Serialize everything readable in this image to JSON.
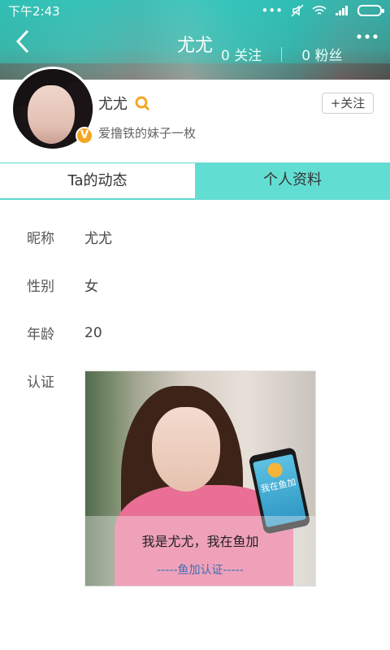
{
  "status_bar": {
    "time": "下午2:43",
    "signal_dots": "•••"
  },
  "header": {
    "title": "尤尤",
    "following": "0 关注",
    "followers": "0 粉丝"
  },
  "profile": {
    "nickname": "尤尤",
    "signature": "爱撸铁的妹子一枚",
    "badge": "V",
    "follow_button": "+关注"
  },
  "tabs": [
    {
      "label": "Ta的动态",
      "active": false
    },
    {
      "label": "个人资料",
      "active": true
    }
  ],
  "info": {
    "nickname_label": "昵称",
    "nickname_value": "尤尤",
    "gender_label": "性别",
    "gender_value": "女",
    "age_label": "年龄",
    "age_value": "20",
    "cert_label": "认证"
  },
  "certification": {
    "caption": "我是尤尤，我在鱼加",
    "sub_caption": "-----鱼加认证-----",
    "phone_text": "我在鱼加"
  },
  "colors": {
    "accent": "#62ddd2",
    "badge": "#f4a623",
    "link": "#3b6fb0"
  }
}
